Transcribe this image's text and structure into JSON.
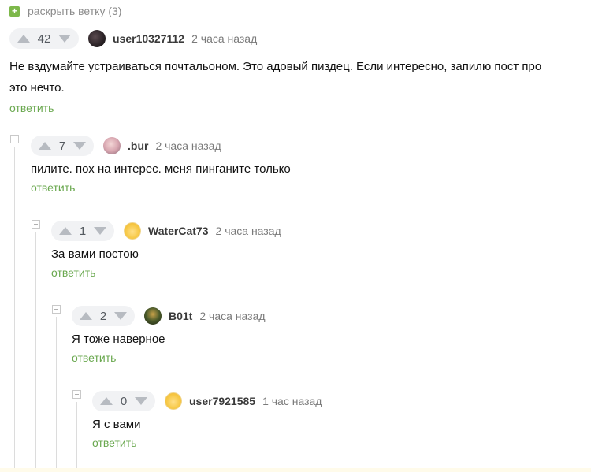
{
  "expand": {
    "label": "раскрыть ветку (3)"
  },
  "colors": {
    "accent_green": "#6aa84f",
    "rating_bg": "#f1f2f4"
  },
  "comments": [
    {
      "rating": "42",
      "author": "user10327112",
      "time": "2 часа назад",
      "text_line1": "Не вздумайте устраиваться почтальоном. Это адовый пиздец. Если интересно, запилю пост про",
      "text_line2": "это нечто.",
      "reply": "ответить",
      "avatar_icon": "user-avatar-dark"
    },
    {
      "rating": "7",
      "author": ".bur",
      "time": "2 часа назад",
      "text": "пилите. пох на интерес. меня пинганите только",
      "reply": "ответить",
      "avatar_icon": "user-avatar-pink"
    },
    {
      "rating": "1",
      "author": "WaterCat73",
      "time": "2 часа назад",
      "text": "За вами постою",
      "reply": "ответить",
      "avatar_icon": "default-avatar"
    },
    {
      "rating": "2",
      "author": "B01t",
      "time": "2 часа назад",
      "text": "Я тоже наверное",
      "reply": "ответить",
      "avatar_icon": "user-avatar-dark-green"
    },
    {
      "rating": "0",
      "author": "user7921585",
      "time": "1 час назад",
      "text": "Я с вами",
      "reply": "ответить",
      "avatar_icon": "default-avatar"
    }
  ]
}
